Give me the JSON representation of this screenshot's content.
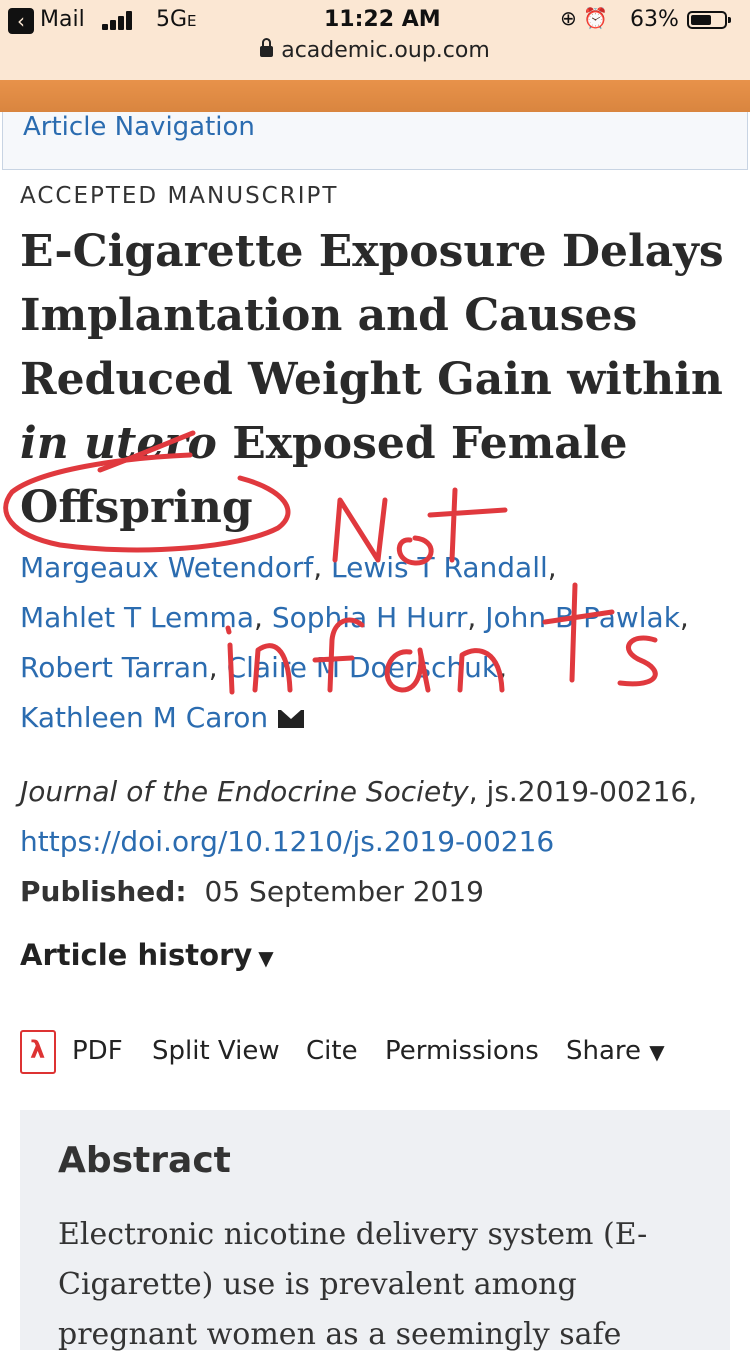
{
  "status_bar": {
    "back_app": "Mail",
    "network": "5G",
    "network_suffix": "E",
    "time": "11:22 AM",
    "battery_percent": "63%",
    "battery_level": 0.63
  },
  "url_bar": {
    "domain": "academic.oup.com"
  },
  "article_nav": {
    "label": "Article Navigation"
  },
  "article": {
    "status_label": "ACCEPTED MANUSCRIPT",
    "title_part1": "E-Cigarette Exposure Delays Implantation and Causes Reduced Weight Gain within ",
    "title_italic": "in utero",
    "title_part2": " Exposed Female Offspring",
    "authors": [
      "Margeaux Wetendorf",
      "Lewis T Randall",
      "Mahlet T Lemma",
      "Sophia H Hurr",
      "John B Pawlak",
      "Robert Tarran",
      "Claire M Doerschuk",
      "Kathleen M Caron"
    ],
    "journal": "Journal of the Endocrine Society",
    "article_id": ", js.2019-00216,",
    "doi": "https://doi.org/10.1210/js.2019-00216",
    "published_label": "Published:",
    "published_date": "05 September 2019",
    "history_label": "Article history"
  },
  "toolbar": {
    "pdf": "PDF",
    "split_view": "Split View",
    "cite": "Cite",
    "permissions": "Permissions",
    "share": "Share"
  },
  "abstract": {
    "heading": "Abstract",
    "text": "Electronic nicotine delivery system (E-Cigarette) use is prevalent among pregnant women as a seemingly safe"
  },
  "annotation": {
    "handwriting_line1": "Not",
    "handwriting_line2": "infants",
    "ink_color": "#e0393e"
  }
}
